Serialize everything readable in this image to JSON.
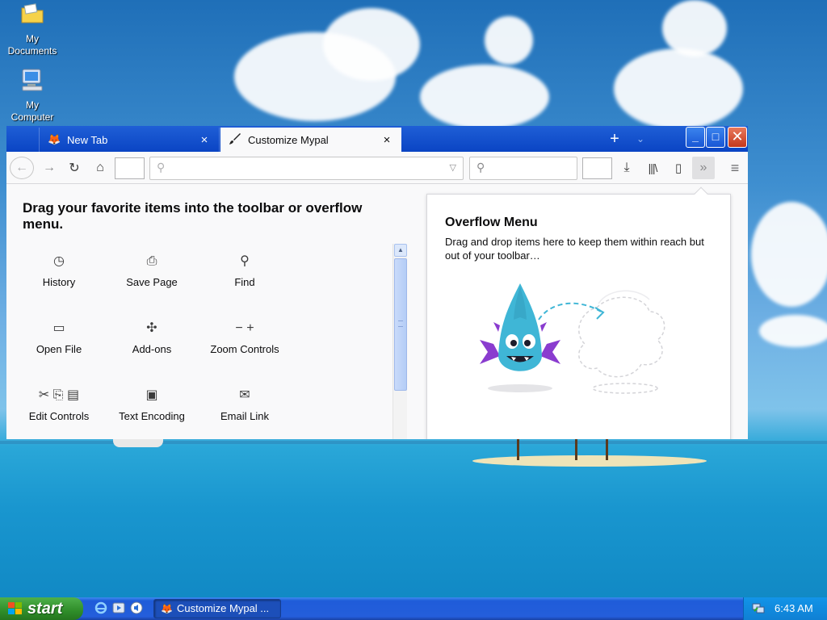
{
  "desktop": {
    "icons": [
      {
        "label_line1": "My",
        "label_line2": "Documents",
        "icon": "folder-icon"
      },
      {
        "label_line1": "My",
        "label_line2": "Computer",
        "icon": "computer-icon"
      }
    ]
  },
  "browser": {
    "tabs": [
      {
        "label": "New Tab",
        "icon": "mypal-logo-icon",
        "active": false
      },
      {
        "label": "Customize Mypal",
        "icon": "paintbrush-icon",
        "active": true
      }
    ],
    "tab_close_glyph": "×",
    "new_tab_glyph": "+",
    "tabs_menu_glyph": "⌄",
    "window_controls": {
      "minimize": "_",
      "maximize": "□",
      "close": "✕"
    },
    "nav": {
      "back_glyph": "←",
      "forward_glyph": "→",
      "reload_glyph": "↻",
      "home_glyph": "⌂",
      "url_value": "",
      "url_placeholder": "",
      "search_value": "",
      "search_placeholder": "",
      "download_glyph": "⤓",
      "library_glyph": "|||\\",
      "sidebar_glyph": "▯",
      "overflow_glyph": "»",
      "menu_glyph": "≡"
    },
    "customize": {
      "title": "Drag your favorite items into the toolbar or overflow menu.",
      "items": [
        {
          "label": "History",
          "icon": "clock-icon",
          "glyph": "◷"
        },
        {
          "label": "Save Page",
          "icon": "save-page-icon",
          "glyph": "⎙"
        },
        {
          "label": "Find",
          "icon": "magnifier-icon",
          "glyph": "⚲"
        },
        {
          "label": "Open File",
          "icon": "open-file-icon",
          "glyph": "▭"
        },
        {
          "label": "Add-ons",
          "icon": "puzzle-icon",
          "glyph": "✣"
        },
        {
          "label": "Zoom Controls",
          "icon": "zoom-controls-icon",
          "glyph": "− +"
        },
        {
          "label": "Edit Controls",
          "icon": "edit-controls-icon",
          "glyph": "✂ ⎘ ▤"
        },
        {
          "label": "Text Encoding",
          "icon": "text-encoding-icon",
          "glyph": "▣"
        },
        {
          "label": "Email Link",
          "icon": "envelope-icon",
          "glyph": "✉"
        }
      ]
    },
    "overflow_panel": {
      "title": "Overflow Menu",
      "description": "Drag and drop items here to keep them within reach but out of your toolbar…",
      "illustration": "dragon-mascot-illustration"
    }
  },
  "taskbar": {
    "start_label": "start",
    "quick_launch": [
      "ie-icon",
      "media-icon",
      "volume-icon"
    ],
    "task_button_label": "Customize Mypal ...",
    "clock": "6:43 AM"
  },
  "colors": {
    "xp_blue": "#245edb",
    "start_green": "#2f8d2a",
    "close_red": "#c4381c",
    "dragon_teal": "#3fb6d6",
    "dragon_purple": "#8a3ccf"
  }
}
